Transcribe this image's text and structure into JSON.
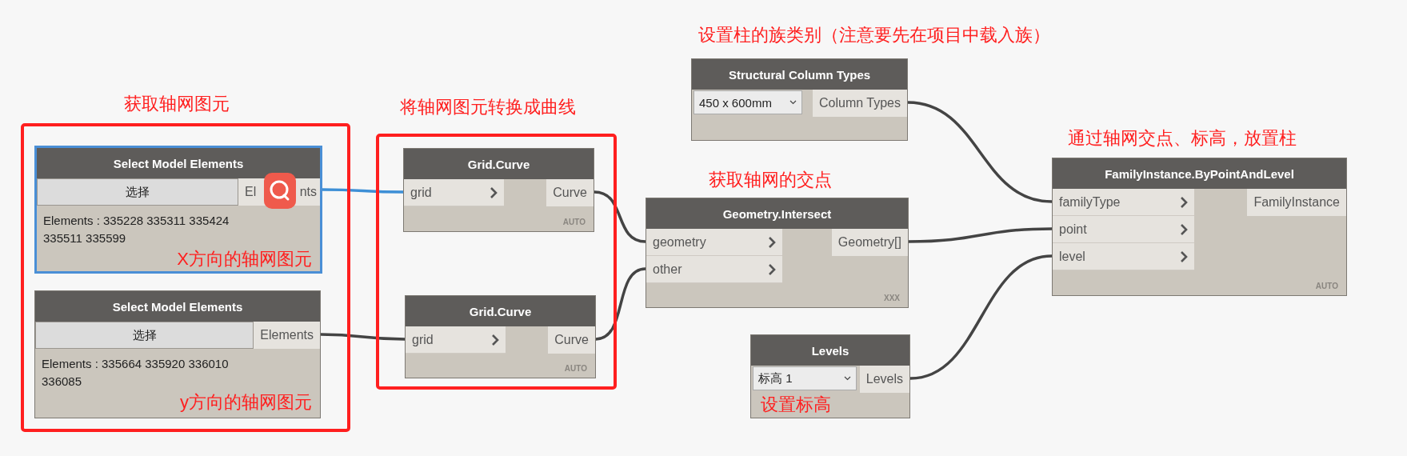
{
  "groups": [
    {
      "title": "获取轴网图元"
    },
    {
      "title": "将轴网图元转换成曲线"
    }
  ],
  "notes": [
    {
      "text": "设置柱的族类别（注意要先在项目中载入族）"
    },
    {
      "text": "获取轴网的交点"
    },
    {
      "text": "通过轴网交点、标高，放置柱"
    }
  ],
  "nodes": [
    {
      "kind": "select",
      "title": "Select Model Elements",
      "selected": true,
      "button": "选择",
      "outputs": [
        "El nts"
      ],
      "value": "Elements : 335228 335311 335424 335511 335599",
      "note": "X方向的轴网图元"
    },
    {
      "kind": "select",
      "title": "Select Model Elements",
      "selected": false,
      "button": "选择",
      "outputs": [
        "Elements"
      ],
      "value": "Elements : 335664 335920 336010 336085",
      "note": "y方向的轴网图元"
    },
    {
      "kind": "function",
      "title": "Grid.Curve",
      "selected": false,
      "inputs": [
        "grid"
      ],
      "outputs": [
        "Curve"
      ],
      "lacing": "AUTO"
    },
    {
      "kind": "function",
      "title": "Grid.Curve",
      "selected": false,
      "inputs": [
        "grid"
      ],
      "outputs": [
        "Curve"
      ],
      "lacing": "AUTO"
    },
    {
      "kind": "dropdown",
      "title": "Structural Column Types",
      "selected": false,
      "choice": "450 x 600mm",
      "outputs": [
        "Column Types"
      ]
    },
    {
      "kind": "function",
      "title": "Geometry.Intersect",
      "selected": false,
      "inputs": [
        "geometry",
        "other"
      ],
      "outputs": [
        "Geometry[]"
      ],
      "lacing": "XXX"
    },
    {
      "kind": "dropdown",
      "title": "Levels",
      "selected": false,
      "choice": "标高 1",
      "outputs": [
        "Levels"
      ],
      "note": "设置标高"
    },
    {
      "kind": "function",
      "title": "FamilyInstance.ByPointAndLevel",
      "selected": false,
      "inputs": [
        "familyType",
        "point",
        "level"
      ],
      "outputs": [
        "FamilyInstance"
      ],
      "lacing": "AUTO"
    }
  ]
}
